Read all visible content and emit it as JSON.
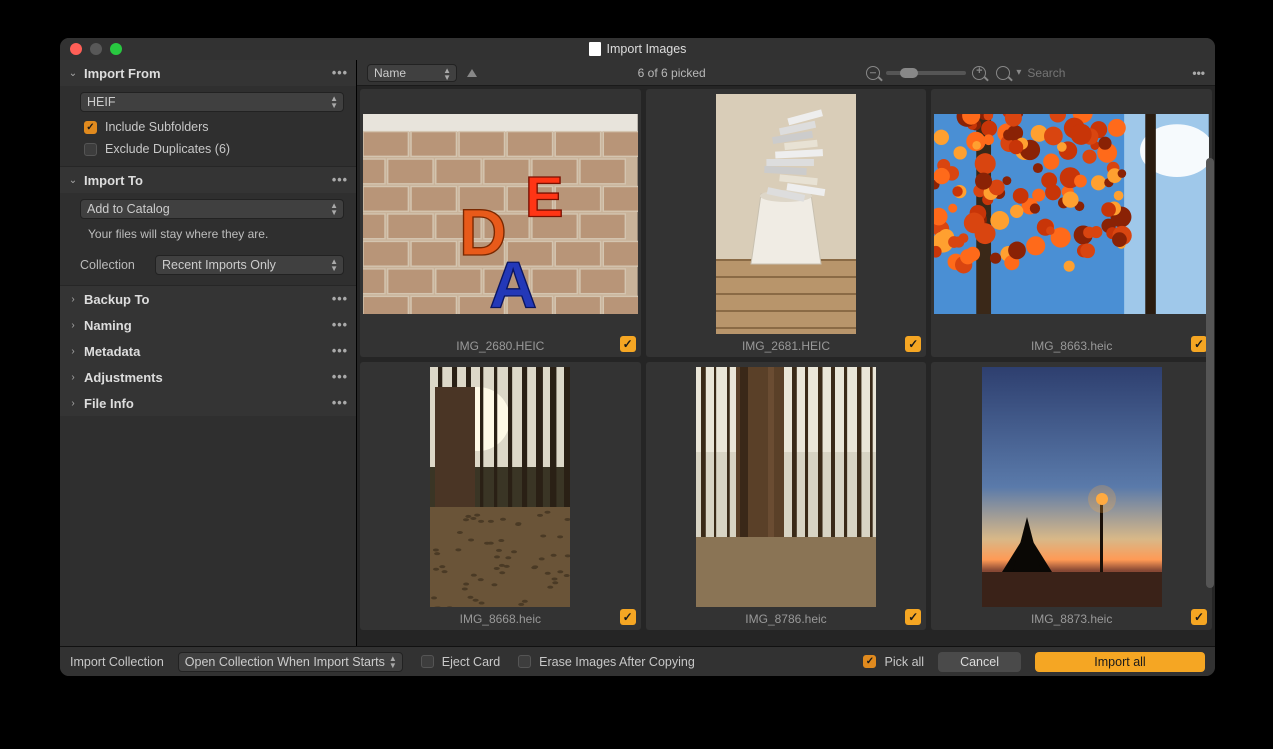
{
  "window": {
    "title": "Import Images"
  },
  "sidebar": {
    "import_from": {
      "title": "Import From",
      "source_value": "HEIF",
      "include_subfolders": {
        "label": "Include Subfolders",
        "checked": true
      },
      "exclude_duplicates": {
        "label": "Exclude Duplicates (6)",
        "checked": false
      }
    },
    "import_to": {
      "title": "Import To",
      "mode_value": "Add to Catalog",
      "helper": "Your files will stay where they are.",
      "collection_label": "Collection",
      "collection_value": "Recent Imports Only"
    },
    "collapsed": [
      {
        "title": "Backup To"
      },
      {
        "title": "Naming"
      },
      {
        "title": "Metadata"
      },
      {
        "title": "Adjustments"
      },
      {
        "title": "File Info"
      }
    ]
  },
  "toolbar": {
    "sort_value": "Name",
    "picked_status": "6 of 6 picked",
    "search_placeholder": "Search"
  },
  "thumbs": [
    {
      "name": "IMG_2680.HEIC",
      "picked": true,
      "kind": "brick"
    },
    {
      "name": "IMG_2681.HEIC",
      "picked": true,
      "kind": "bucket"
    },
    {
      "name": "IMG_8663.heic",
      "picked": true,
      "kind": "autumn"
    },
    {
      "name": "IMG_8668.heic",
      "picked": true,
      "kind": "forest1"
    },
    {
      "name": "IMG_8786.heic",
      "picked": true,
      "kind": "forest2"
    },
    {
      "name": "IMG_8873.heic",
      "picked": true,
      "kind": "dusk"
    }
  ],
  "footer": {
    "import_collection_label": "Import Collection",
    "import_collection_value": "Open Collection When Import Starts",
    "eject_card": {
      "label": "Eject Card",
      "checked": false
    },
    "erase_after": {
      "label": "Erase Images After Copying",
      "checked": false
    },
    "pick_all": {
      "label": "Pick all",
      "checked": true
    },
    "cancel": "Cancel",
    "import_all": "Import all"
  },
  "colors": {
    "accent": "#f5a623"
  }
}
